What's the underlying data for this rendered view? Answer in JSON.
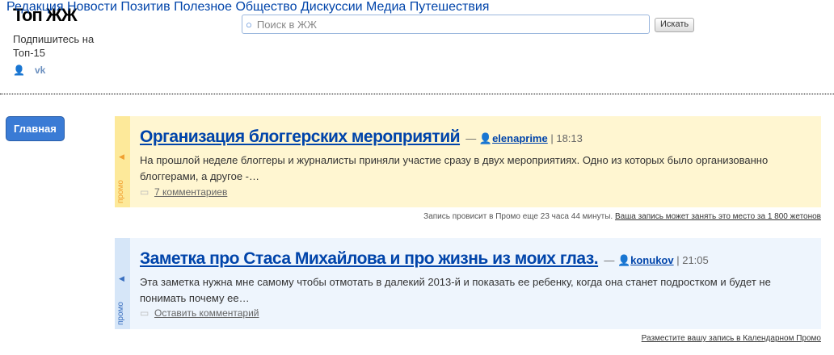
{
  "header": {
    "title": "Топ ЖЖ",
    "subscribe": "Подпишитесь на Топ-15",
    "vk_icon": "vk"
  },
  "search": {
    "placeholder": "Поиск в ЖЖ",
    "button": "Искать"
  },
  "nav": {
    "main": "Главная",
    "items": [
      "Редакция",
      "Новости",
      "Позитив",
      "Полезное",
      "Общество",
      "Дискуссии",
      "Медиа",
      "Путешествия"
    ]
  },
  "posts": [
    {
      "label": "промо",
      "title": "Организация блоггерских мероприятий",
      "dash": "—",
      "author": "elenaprime",
      "time": "| 18:13",
      "text": "На прошлой неделе блоггеры и журналисты приняли участие сразу в двух мероприятиях. Одно из которых было организованно блоггерами, а другое -…",
      "comments": "7 комментариев",
      "note": "Запись провисит в Промо еще 23 часа 44 минуты.",
      "note_link": "Ваша запись может занять это место за 1 800 жетонов",
      "bg": "#fff6d1",
      "stripe": "#fde99a",
      "accent": "#f0a030"
    },
    {
      "label": "промо",
      "title": "Заметка про Стаса Михайлова и про жизнь из моих глаз.",
      "dash": "—",
      "author": "konukov",
      "time": "| 21:05",
      "text": "Эта заметка нужна мне самому чтобы отмотать в далекий 2013-й и показать ее ребенку, когда она станет подростком и будет не понимать почему ее…",
      "comments": "Оставить комментарий",
      "note": "",
      "note_link": "Разместите вашу запись в Календарном Промо",
      "bg": "#eef5fd",
      "stripe": "#d6e6f8",
      "accent": "#3a70c0"
    }
  ]
}
